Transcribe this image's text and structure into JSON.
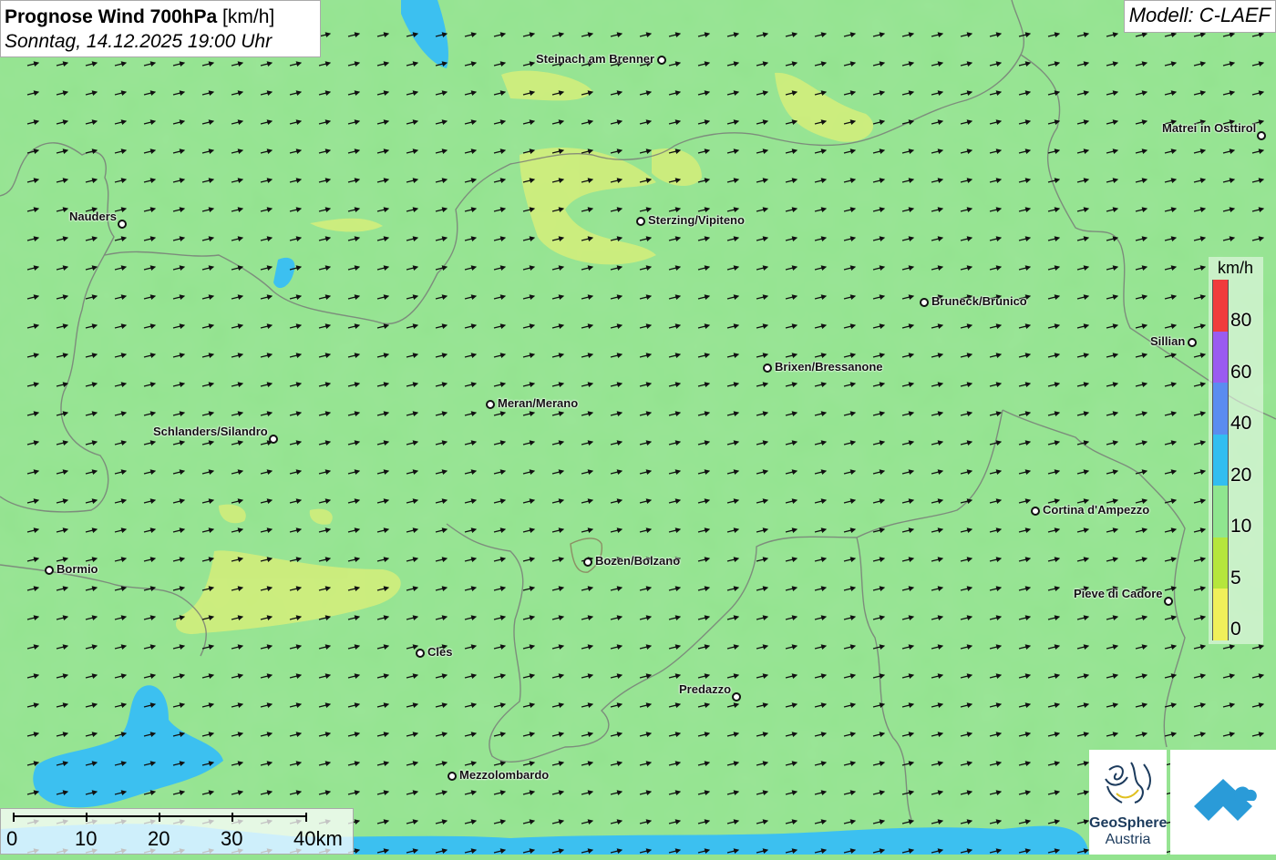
{
  "title": {
    "bold": "Prognose Wind 700hPa",
    "unit": "[km/h]",
    "datetime": "Sonntag, 14.12.2025 19:00 Uhr"
  },
  "model": "Modell: C-LAEF",
  "legend": {
    "unit": "km/h",
    "labels": [
      "80",
      "60",
      "40",
      "20",
      "10",
      "5",
      "0"
    ],
    "colors": [
      "#f03c3c",
      "#9a5cf0",
      "#5a8cf0",
      "#32bef0",
      "#8fe68f",
      "#b5e63c",
      "#f0f05a"
    ]
  },
  "scalebar": {
    "labels": [
      "0",
      "10",
      "20",
      "30",
      "40km"
    ]
  },
  "logos": {
    "geosphere_line1": "GeoSphere",
    "geosphere_line2": "Austria"
  },
  "cities": [
    {
      "name": "Steinach am Brenner"
    },
    {
      "name": "Matrei in Osttirol"
    },
    {
      "name": "Nauders"
    },
    {
      "name": "Sterzing/Vipiteno"
    },
    {
      "name": "Bruneck/Brunico"
    },
    {
      "name": "Sillian"
    },
    {
      "name": "Brixen/Bressanone"
    },
    {
      "name": "Meran/Merano"
    },
    {
      "name": "Schlanders/Silandro"
    },
    {
      "name": "Cortina d'Ampezzo"
    },
    {
      "name": "Bormio"
    },
    {
      "name": "Bozen/Bolzano"
    },
    {
      "name": "Pieve di Cadore"
    },
    {
      "name": "Cles"
    },
    {
      "name": "Predazzo"
    },
    {
      "name": "Mezzolombardo"
    }
  ]
}
